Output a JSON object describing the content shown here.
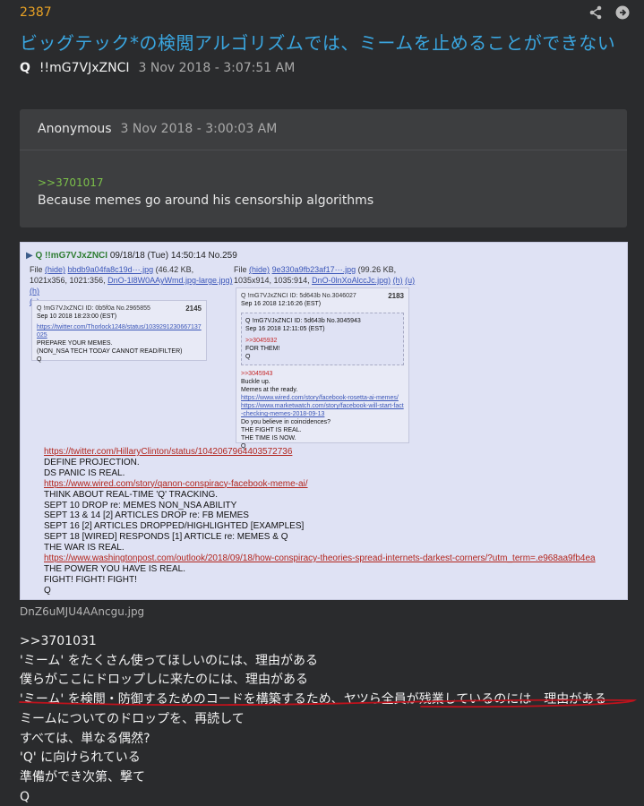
{
  "post": {
    "number": "2387",
    "title": "ビッグテック*の検閲アルゴリズムでは、ミームを止めることができない",
    "author": "Q",
    "tripcode": "!!mG7VJxZNCI",
    "date": "3 Nov 2018 - 3:07:51 AM"
  },
  "quoted": {
    "author": "Anonymous",
    "date": "3 Nov 2018 - 3:00:03 AM",
    "ref": ">>3701017",
    "text": "Because memes go around his censorship algorithms"
  },
  "screenshot": {
    "header_q": "Q !!mG7VJxZNCI",
    "header_rest": "09/18/18 (Tue) 14:50:14 No.259",
    "file1": {
      "label": "File",
      "hide": "(hide)",
      "name": "bbdb9a04fa8c19d···.jpg",
      "meta": "(46.42 KB,",
      "meta2": "1021x356, 1021:356,",
      "alt": "DnO-1l8W0AAyWmd.jpg-large.jpg)",
      "h": "(h)",
      "u": "(u)"
    },
    "file2": {
      "label": "File",
      "hide": "(hide)",
      "name": "9e330a9fb23af17···.jpg",
      "meta": "(99.26 KB,",
      "meta2": "1035x914, 1035:914,",
      "alt": "DnO-0lnXoAlccJc.jpg)",
      "h": "(h)",
      "u": "(u)"
    },
    "mini1": {
      "head": "Q !mG7VJxZNCI",
      "id": "ID: 0b5f0a",
      "no": "No.2965855",
      "date": "Sep 10 2018 18:23:00 (EST)",
      "num": "2145",
      "link": "https://twitter.com/Thorlock1248/status/1039291230667137025",
      "l1": "PREPARE YOUR MEMES.",
      "l2": "(NON_NSA TECH TODAY CANNOT READ/FILTER)",
      "l3": "Q"
    },
    "mini2": {
      "head": "Q !mG7VJxZNCI",
      "id": "ID: 5d643b",
      "no": "No.3046027",
      "date": "Sep 16 2018 12:16:26 (EST)",
      "num": "2183",
      "inner_head": "Q !mG7VJxZNCI",
      "inner_id": "ID: 5d643b",
      "inner_no": "No.3045943",
      "inner_date": "Sep 16 2018 12:11:05 (EST)",
      "inner_ref": ">>3045932",
      "inner_l1": "FOR THEM!",
      "inner_l2": "Q",
      "ref": ">>3045943",
      "l1": "Buckle up.",
      "l2": "Memes at the ready.",
      "link1": "https://www.wired.com/story/facebook-rosetta-ai-memes/",
      "link2": "https://www.marketwatch.com/story/facebook-will-start-fact-checking-memes-2018-09-13",
      "l3": "Do you believe in coincidences?",
      "l4": "THE FIGHT IS REAL.",
      "l5": "THE TIME IS NOW.",
      "l6": "Q"
    },
    "body": [
      {
        "t": "https://twitter.com/HillaryClinton/status/1042067964403572736",
        "link": true
      },
      {
        "t": "DEFINE PROJECTION.",
        "link": false
      },
      {
        "t": "DS PANIC IS REAL.",
        "link": false
      },
      {
        "t": "https://www.wired.com/story/qanon-conspiracy-facebook-meme-ai/",
        "link": true
      },
      {
        "t": "THINK ABOUT REAL-TIME 'Q' TRACKING.",
        "link": false
      },
      {
        "t": "SEPT 10 DROP re: MEMES NON_NSA ABILITY",
        "link": false
      },
      {
        "t": "SEPT 13 & 14 [2] ARTICLES DROP re: FB MEMES",
        "link": false
      },
      {
        "t": "SEPT 16 [2] ARTICLES DROPPED/HIGHLIGHTED [EXAMPLES]",
        "link": false
      },
      {
        "t": "SEPT 18 [WIRED] RESPONDS [1] ARTICLE re: MEMES & Q",
        "link": false
      },
      {
        "t": "THE WAR IS REAL.",
        "link": false
      },
      {
        "t": "https://www.washingtonpost.com/outlook/2018/09/18/how-conspiracy-theories-spread-internets-darkest-corners/?utm_term=.e968aa9fb4ea",
        "link": true
      },
      {
        "t": "THE POWER YOU HAVE IS REAL.",
        "link": false
      },
      {
        "t": "FIGHT! FIGHT! FIGHT!",
        "link": false
      },
      {
        "t": "Q",
        "link": false
      }
    ]
  },
  "filename": "DnZ6uMJU4AAncgu.jpg",
  "translation": [
    ">>3701031",
    "'ミーム' をたくさん使ってほしいのには、理由がある",
    "僕らがここにドロップしに来たのには、理由がある",
    "'ミーム' を検閲・防御するためのコードを構築するため、ヤツら全員が残業しているのには　理由がある",
    "ミームについてのドロップを、再読して",
    "すべては、単なる偶然?",
    "'Q' に向けられている",
    "準備ができ次第、撃て",
    "Q"
  ],
  "colors": {
    "background": "#2a2b2d",
    "accent_title": "#3aa6e0",
    "post_number": "#e9a224",
    "reply_ref": "#7cc04a",
    "underline": "#c0121c"
  }
}
